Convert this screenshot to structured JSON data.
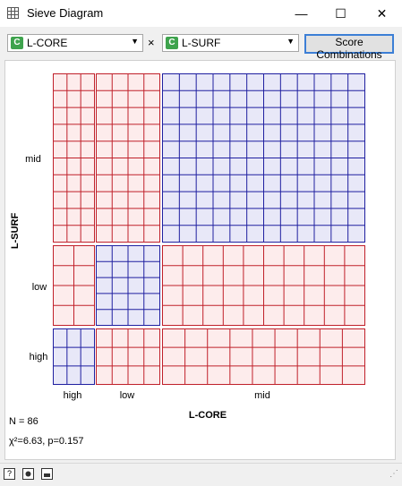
{
  "window": {
    "title": "Sieve Diagram",
    "minimize_glyph": "—",
    "maximize_glyph": "☐",
    "close_glyph": "✕",
    "icon": "sieve-app-icon"
  },
  "toolbar": {
    "attr1": {
      "icon_letter": "C",
      "value": "L-CORE"
    },
    "times_symbol": "×",
    "attr2": {
      "icon_letter": "C",
      "value": "L-SURF"
    },
    "dropdown_glyph": "▼",
    "score_label": "Score Combinations"
  },
  "diagram": {
    "x_axis_title": "L-CORE",
    "y_axis_title": "L-SURF",
    "x_categories": [
      "high",
      "low",
      "mid"
    ],
    "y_categories": [
      "mid",
      "low",
      "high"
    ],
    "colors": {
      "positive": "#1f1fa0",
      "positive_fill": "#e8e8f8",
      "negative": "#c0202a",
      "negative_fill": "#fdecec"
    },
    "n_text": "N = 86",
    "chi_text": "χ²=6.63, p=0.157"
  },
  "statusbar": {
    "icons": [
      "help-icon",
      "report-icon",
      "export-icon"
    ],
    "help_glyph": "?",
    "resize_glyph": "⋰"
  }
}
